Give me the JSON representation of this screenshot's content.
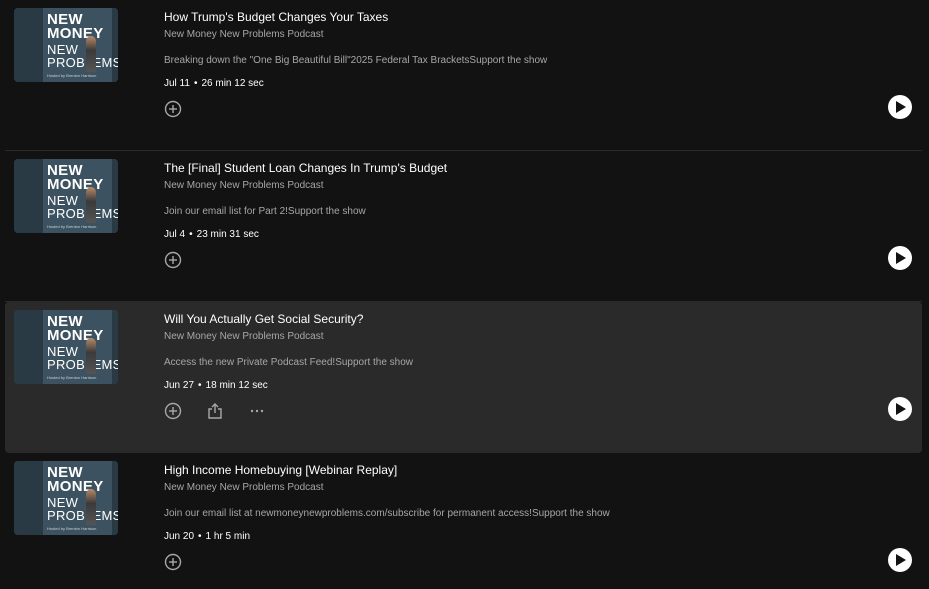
{
  "episodes": [
    {
      "title": "How Trump's Budget Changes Your Taxes",
      "show": "New Money New Problems Podcast",
      "description": "Breaking down the \"One Big Beautiful Bill\"2025 Federal Tax BracketsSupport the show",
      "date": "Jul 11",
      "duration": "26 min 12 sec",
      "hovered": false
    },
    {
      "title": "The [Final] Student Loan Changes In Trump's Budget",
      "show": "New Money New Problems Podcast",
      "description": "Join our email list for Part 2!Support the show",
      "date": "Jul 4",
      "duration": "23 min 31 sec",
      "hovered": false
    },
    {
      "title": "Will You Actually Get Social Security?",
      "show": "New Money New Problems Podcast",
      "description": "Access the new Private Podcast Feed!Support the show",
      "date": "Jun 27",
      "duration": "18 min 12 sec",
      "hovered": true
    },
    {
      "title": "High Income Homebuying [Webinar Replay]",
      "show": "New Money New Problems Podcast",
      "description": "Join our email list at newmoneynewproblems.com/subscribe for permanent access!Support the show",
      "date": "Jun 20",
      "duration": "1 hr 5 min",
      "hovered": false
    }
  ],
  "cover_art": {
    "line1": "NEW",
    "line2": "MONEY",
    "line3": "NEW",
    "line4": "PROBLEMS",
    "byline": "Hosted by Brenton Harrison"
  },
  "meta_separator": "•",
  "icons": {
    "add": "add-circle-icon",
    "share": "share-icon",
    "more": "more-options-icon",
    "play": "play-icon"
  },
  "colors": {
    "background": "#121212",
    "hover_row": "#2a2a2a",
    "primary_text": "#ffffff",
    "secondary_text": "#a7a7a7"
  }
}
